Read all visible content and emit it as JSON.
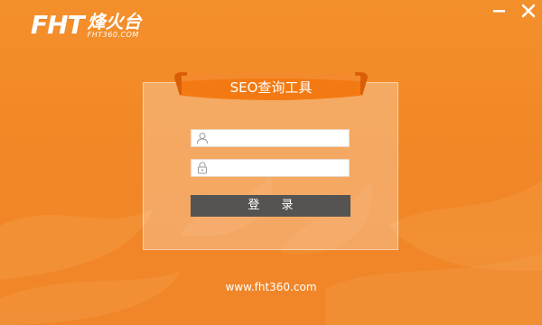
{
  "brand": {
    "logo_mark": "FHT",
    "logo_cn": "烽火台",
    "logo_sub": "FHT360.COM"
  },
  "window_controls": {
    "minimize_icon": "minimize-icon",
    "close_icon": "close-icon"
  },
  "login": {
    "title": "SEO查询工具",
    "username": {
      "value": "",
      "placeholder": "",
      "icon": "user-icon"
    },
    "password": {
      "value": "",
      "placeholder": "",
      "icon": "lock-icon"
    },
    "submit_label": "登 录"
  },
  "footer": {
    "url": "www.fht360.com"
  },
  "colors": {
    "background": "#f07d14",
    "ribbon": "#f37a12",
    "button": "#555453",
    "panel_overlay": "rgba(255,255,255,0.28)"
  }
}
